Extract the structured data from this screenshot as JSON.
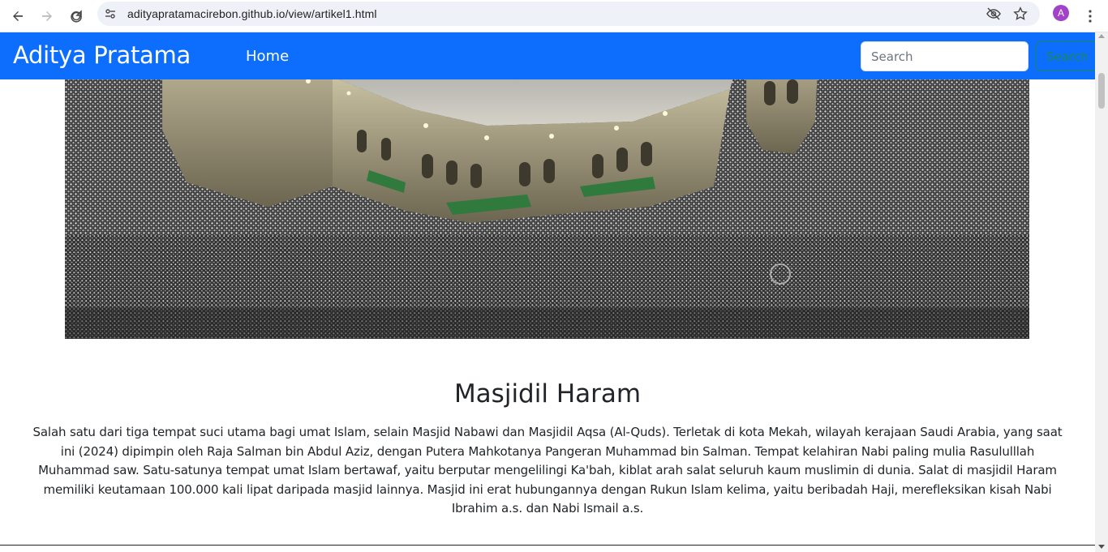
{
  "browser": {
    "url": "adityapratamacirebon.github.io/view/artikel1.html",
    "avatar_letter": "A",
    "icons": [
      "back-icon",
      "forward-icon",
      "reload-icon",
      "site-info-icon",
      "eye-off-icon",
      "star-icon",
      "kebab-menu-icon"
    ]
  },
  "navbar": {
    "brand": "Aditya Pratama",
    "home_link": "Home",
    "search_placeholder": "Search",
    "search_button": "Search",
    "background_color": "#0d6efd"
  },
  "article": {
    "title": "Masjidil Haram",
    "body": "Salah satu dari tiga tempat suci utama bagi umat Islam, selain Masjid Nabawi dan Masjidil Aqsa (Al-Quds). Terletak di kota Mekah, wilayah kerajaan Saudi Arabia, yang saat ini (2024) dipimpin oleh Raja Salman bin Abdul Aziz, dengan Putera Mahkotanya Pangeran Muhammad bin Salman. Tempat kelahiran Nabi paling mulia Rasululllah Muhammad saw. Satu-satunya tempat umat Islam bertawaf, yaitu berputar mengelilingi Ka'bah, kiblat arah salat seluruh kaum muslimin di dunia. Salat di masjidil Haram memiliki keutamaan 100.000 kali lipat daripada masjid lainnya. Masjid ini erat hubungannya dengan Rukun Islam kelima, yaitu beribadah Haji, merefleksikan kisah Nabi Ibrahim a.s. dan Nabi Ismail a.s."
  }
}
